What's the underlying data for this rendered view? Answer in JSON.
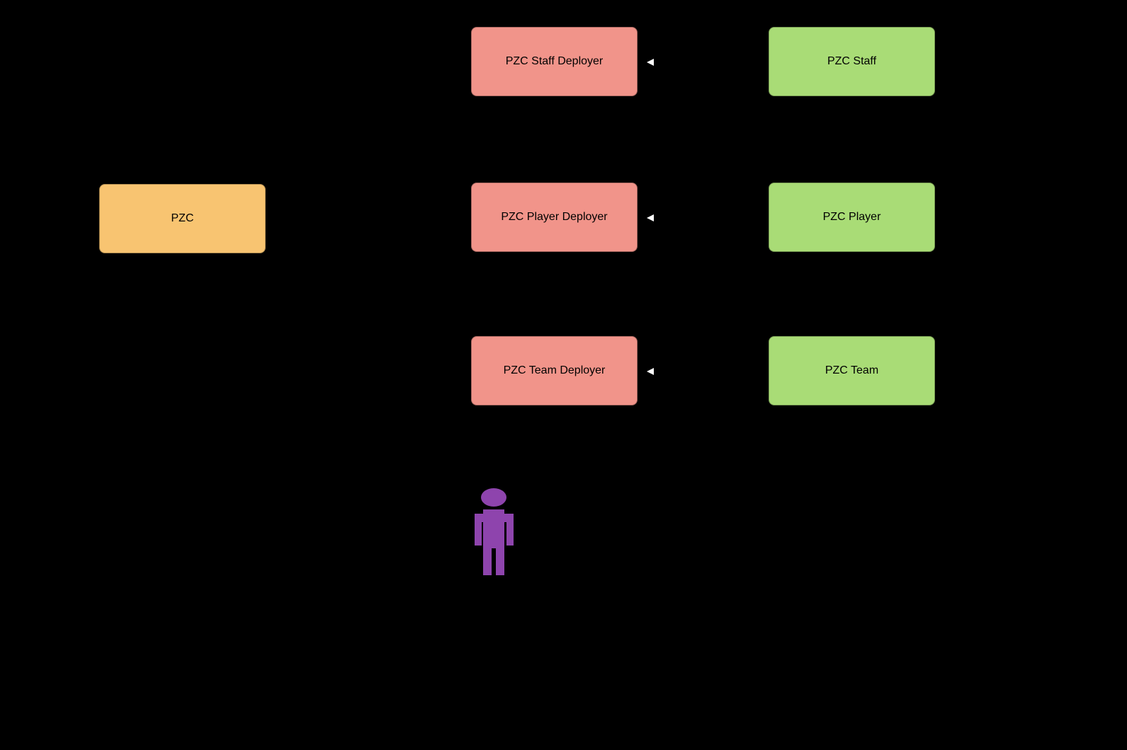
{
  "nodes": {
    "pzc": {
      "label": "PZC",
      "color": "orange"
    },
    "staff_deployer": {
      "label": "PZC Staff Deployer",
      "color": "coral"
    },
    "player_deployer": {
      "label": "PZC Player Deployer",
      "color": "coral"
    },
    "team_deployer": {
      "label": "PZC Team Deployer",
      "color": "coral"
    },
    "staff": {
      "label": "PZC Staff",
      "color": "green"
    },
    "player": {
      "label": "PZC Player",
      "color": "green"
    },
    "team": {
      "label": "PZC Team",
      "color": "green"
    }
  },
  "actor": {
    "name": "human-actor",
    "color": "#8e44ad"
  },
  "edges": [
    {
      "from": "staff",
      "to": "staff_deployer",
      "direction": "left"
    },
    {
      "from": "player",
      "to": "player_deployer",
      "direction": "left"
    },
    {
      "from": "team",
      "to": "team_deployer",
      "direction": "left"
    }
  ]
}
